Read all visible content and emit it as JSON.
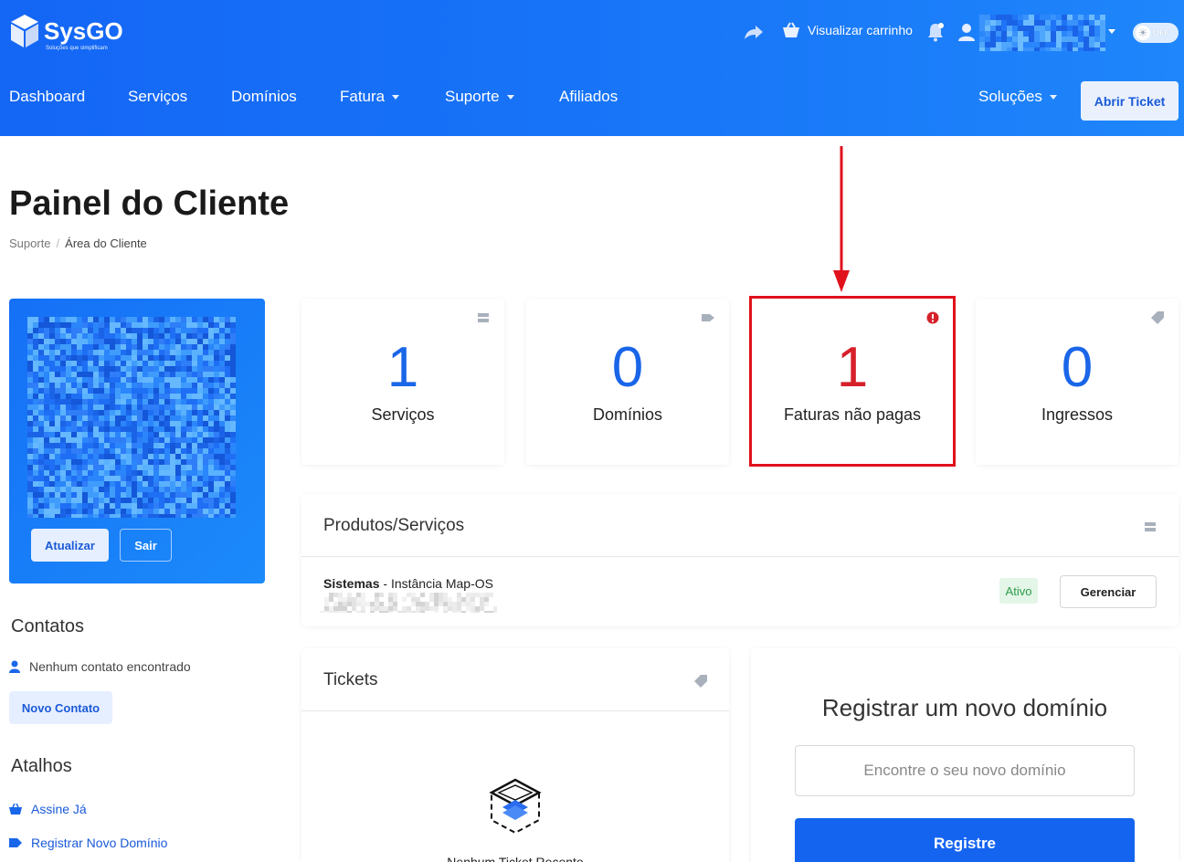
{
  "brand": {
    "name": "SysGO",
    "tagline": "Soluções que simplificam"
  },
  "topbar": {
    "share_icon": "share-arrow-icon",
    "cart_label": "Visualizar carrinho",
    "toggle_label": "OFF"
  },
  "nav": {
    "items": [
      {
        "label": "Dashboard",
        "dropdown": false
      },
      {
        "label": "Serviços",
        "dropdown": false
      },
      {
        "label": "Domínios",
        "dropdown": false
      },
      {
        "label": "Fatura",
        "dropdown": true
      },
      {
        "label": "Suporte",
        "dropdown": true
      },
      {
        "label": "Afiliados",
        "dropdown": false
      }
    ],
    "solutions_label": "Soluções",
    "ticket_button": "Abrir Ticket"
  },
  "page": {
    "title": "Painel do Cliente",
    "breadcrumb": [
      "Suporte",
      "/",
      "Área do Cliente"
    ]
  },
  "profile": {
    "update_button": "Atualizar",
    "logout_button": "Sair"
  },
  "sidebar": {
    "contacts_heading": "Contatos",
    "no_contacts": "Nenhum contato encontrado",
    "new_contact_button": "Novo Contato",
    "shortcuts_heading": "Atalhos",
    "shortcuts": [
      {
        "label": "Assine Já",
        "icon": "basket-icon"
      },
      {
        "label": "Registrar Novo Domínio",
        "icon": "tag-icon"
      }
    ]
  },
  "stats": [
    {
      "value": "1",
      "label": "Serviços",
      "icon": "server-icon",
      "color": "#1a66e8"
    },
    {
      "value": "0",
      "label": "Domínios",
      "icon": "tag-icon",
      "color": "#1a66e8"
    },
    {
      "value": "1",
      "label": "Faturas não pagas",
      "icon": "alert-icon",
      "color": "#d6202a"
    },
    {
      "value": "0",
      "label": "Ingressos",
      "icon": "ticket-icon",
      "color": "#1a66e8"
    }
  ],
  "products": {
    "title": "Produtos/Serviços",
    "item_name": "Sistemas",
    "item_sep": " - ",
    "item_detail": "Instância Map-OS",
    "status": "Ativo",
    "manage_button": "Gerenciar"
  },
  "tickets": {
    "title": "Tickets",
    "empty_text": "Nenhum Ticket Recente"
  },
  "domain": {
    "title": "Registrar um novo domínio",
    "input_placeholder": "Encontre o seu novo domínio",
    "register_button": "Registre"
  },
  "colors": {
    "header": "#1877f8",
    "accent": "#1a66e8",
    "alert": "#d6202a",
    "success": "#2a9b48"
  }
}
